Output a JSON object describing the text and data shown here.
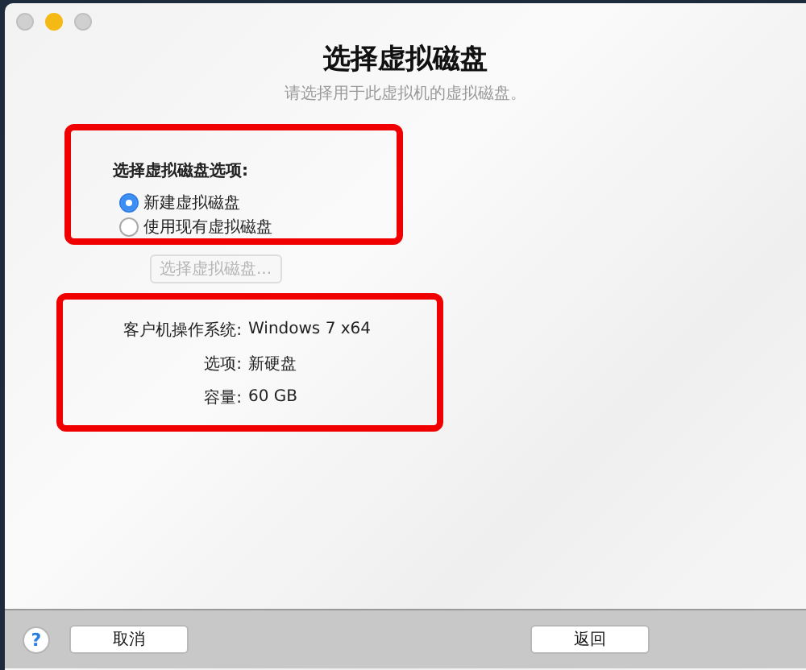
{
  "window": {
    "title": "选择虚拟磁盘",
    "subtitle": "请选择用于此虚拟机的虚拟磁盘。"
  },
  "options": {
    "highlighted": true,
    "heading": "选择虚拟磁盘选项:",
    "radios": [
      {
        "label": "新建虚拟磁盘",
        "selected": true
      },
      {
        "label": "使用现有虚拟磁盘",
        "selected": false
      }
    ],
    "choose_button": {
      "label": "选择虚拟磁盘...",
      "disabled": true
    }
  },
  "summary": {
    "highlighted": true,
    "rows": [
      {
        "label": "客户机操作系统:",
        "value": "Windows 7 x64"
      },
      {
        "label": "选项:",
        "value": "新硬盘"
      },
      {
        "label": "容量:",
        "value": "60 GB"
      }
    ]
  },
  "footer": {
    "help": "?",
    "cancel": "取消",
    "back": "返回"
  }
}
